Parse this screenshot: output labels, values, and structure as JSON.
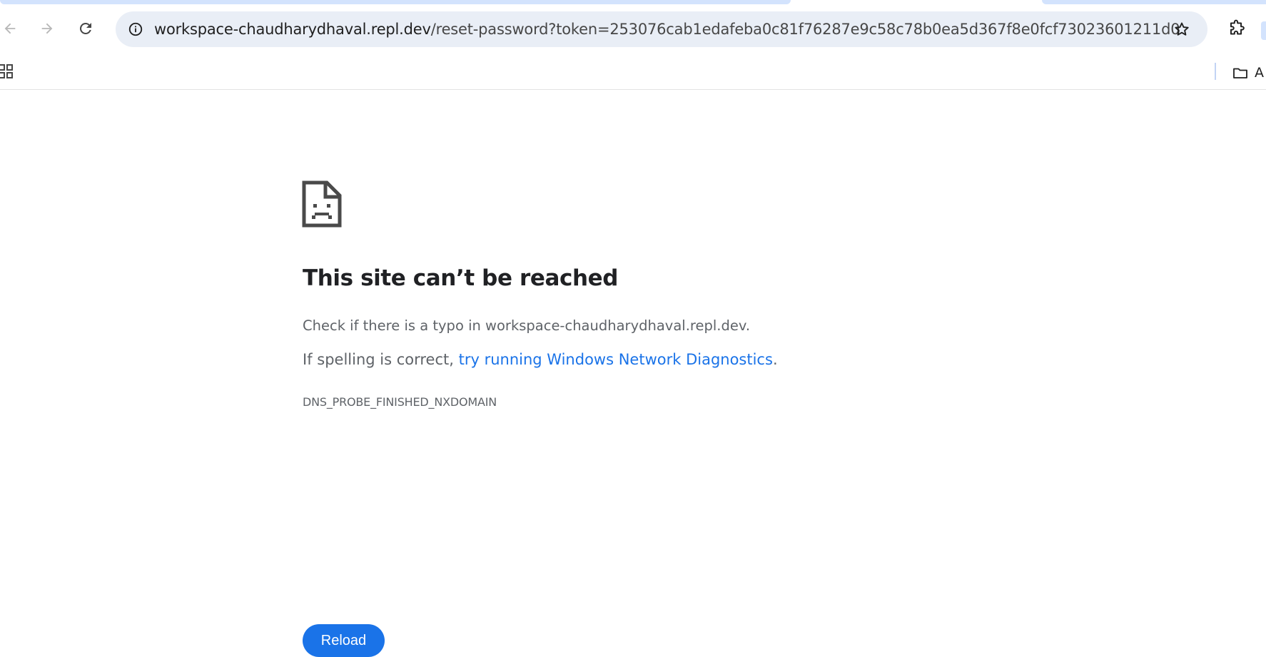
{
  "browser": {
    "url_host": "workspace-chaudharydhaval.repl.dev",
    "url_path": "/reset-password?token=253076cab1edafeba0c81f76287e9c58c78b0ea5d367f8e0fcf73023601211d0",
    "icons": {
      "back": "arrow-left-icon",
      "forward": "arrow-right-icon",
      "reload": "reload-icon",
      "site_info": "info-icon",
      "bookmark": "star-icon",
      "extensions": "puzzle-icon",
      "apps": "apps-grid-icon",
      "folder": "folder-icon"
    },
    "bookmark_folder_label": "A"
  },
  "error_page": {
    "title": "This site can’t be reached",
    "typo_text": "Check if there is a typo in workspace-chaudharydhaval.repl.dev.",
    "spelling_prefix": "If spelling is correct, ",
    "diagnostics_link": "try running Windows Network Diagnostics",
    "spelling_suffix": ".",
    "error_code": "DNS_PROBE_FINISHED_NXDOMAIN",
    "reload_label": "Reload"
  },
  "colors": {
    "accent": "#1a73e8",
    "omnibox_bg": "#e9eef6",
    "heading": "#202124",
    "body_text": "#5f6368"
  }
}
